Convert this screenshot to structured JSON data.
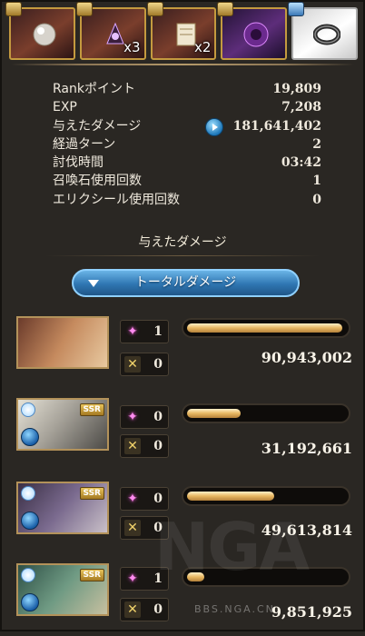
{
  "rewards": [
    {
      "icon": "crystal-orb-icon",
      "qty": ""
    },
    {
      "icon": "dark-rune-icon",
      "qty": "x3"
    },
    {
      "icon": "scroll-icon",
      "qty": "x2"
    },
    {
      "icon": "purple-sphere-icon",
      "qty": ""
    },
    {
      "icon": "ring-icon",
      "qty": ""
    }
  ],
  "stats": [
    {
      "label": "Rankポイント",
      "value": "19,809"
    },
    {
      "label": "EXP",
      "value": "7,208"
    },
    {
      "label": "与えたダメージ",
      "value": "181,641,402"
    },
    {
      "label": "経過ターン",
      "value": "2"
    },
    {
      "label": "討伐時間",
      "value": "03:42"
    },
    {
      "label": "召喚石使用回数",
      "value": "1"
    },
    {
      "label": "エリクシール使用回数",
      "value": "0"
    }
  ],
  "damage_section": {
    "title": "与えたダメージ",
    "dropdown_label": "トータルダメージ"
  },
  "characters": [
    {
      "rarity": "",
      "stat1": "1",
      "stat2": "0",
      "damage": "90,943,002",
      "bar_fraction": 0.98
    },
    {
      "rarity": "SSR",
      "stat1": "0",
      "stat2": "0",
      "damage": "31,192,661",
      "bar_fraction": 0.34
    },
    {
      "rarity": "SSR",
      "stat1": "0",
      "stat2": "0",
      "damage": "49,613,814",
      "bar_fraction": 0.55
    },
    {
      "rarity": "SSR",
      "stat1": "1",
      "stat2": "0",
      "damage": "9,851,925",
      "bar_fraction": 0.11
    }
  ],
  "watermark": {
    "logo": "NGA",
    "url": "BBS.NGA.CN"
  },
  "colors": {
    "accent_gold": "#c49a3f",
    "bar_gold": "#e7b762",
    "dropdown_blue": "#2f76b2"
  }
}
